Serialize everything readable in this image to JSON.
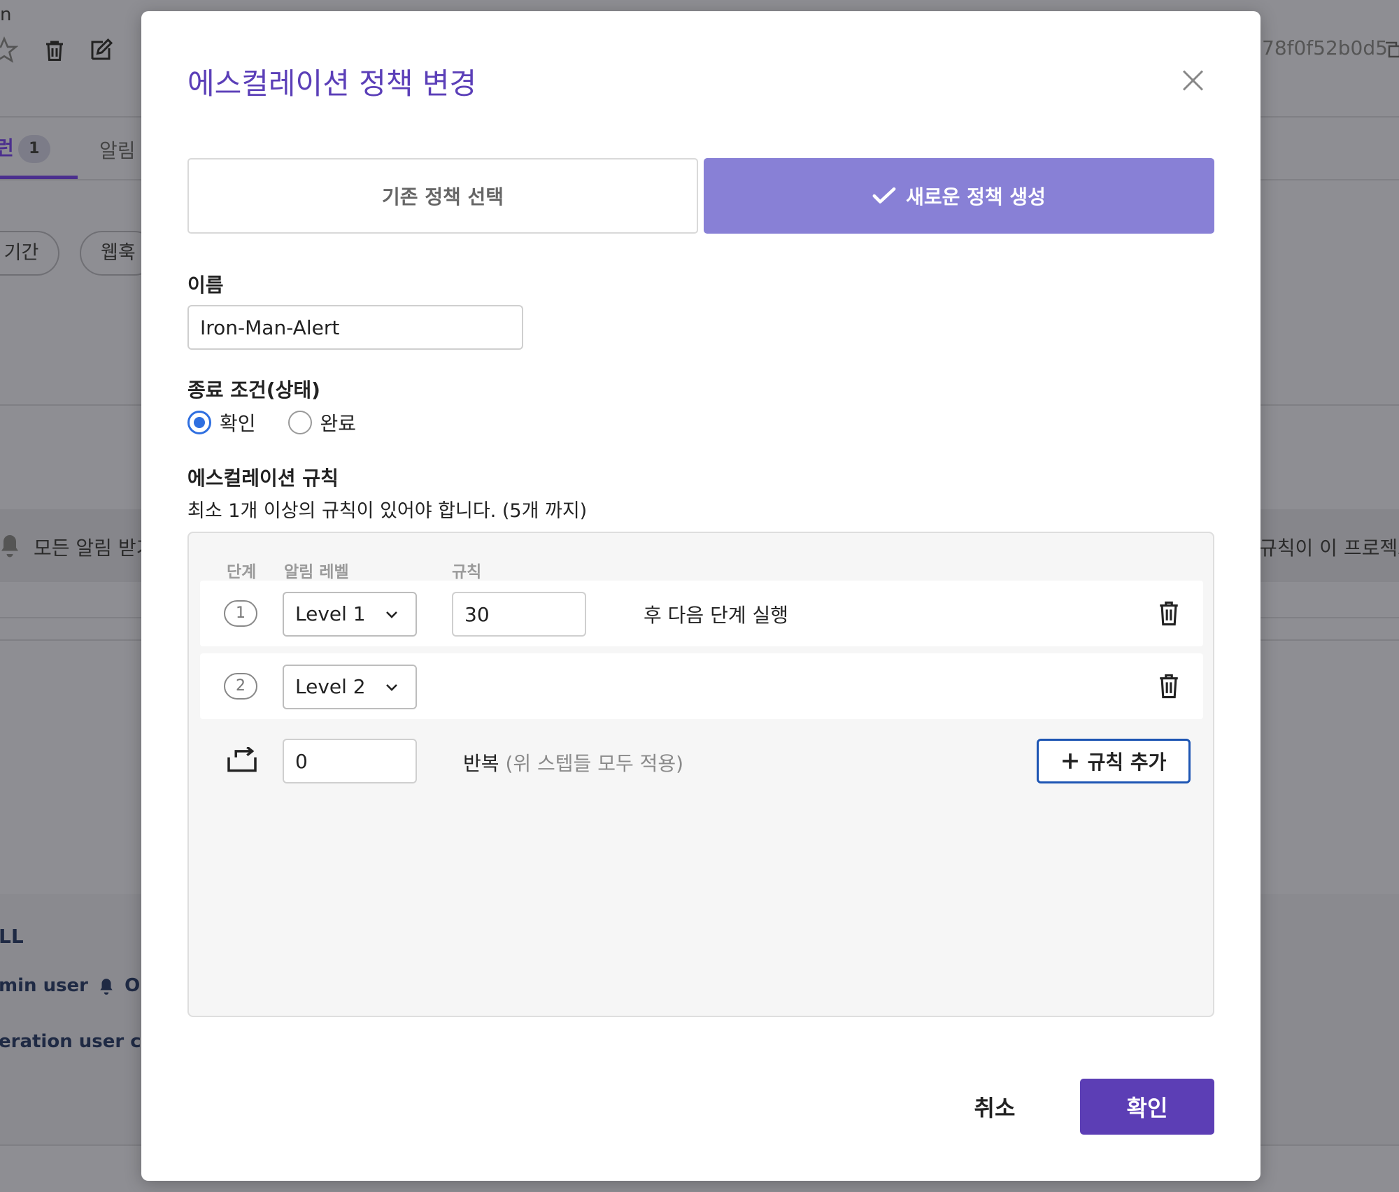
{
  "background": {
    "corner_text": "n",
    "tabs": [
      {
        "label": "런",
        "badge": "1"
      },
      {
        "label": "알림"
      }
    ],
    "filter_pills": [
      "| 기간",
      "웹훅"
    ],
    "hash_text": "78f0f52b0d5",
    "notify_text": "모든 알림 받기",
    "right_rule_text": "규칙이 이 프로젝트",
    "section_title": "LL",
    "user_line_1": {
      "prefix": "min user",
      "status": "ON"
    },
    "user_line_2": "eration user char"
  },
  "modal": {
    "title": "에스컬레이션 정책 변경",
    "segments": {
      "existing": "기존 정책 선택",
      "new": "새로운 정책 생성",
      "active": "new"
    },
    "name": {
      "label": "이름",
      "value": "Iron-Man-Alert"
    },
    "end_condition": {
      "label": "종료 조건(상태)",
      "options": [
        "확인",
        "완료"
      ],
      "selected": "확인"
    },
    "rules": {
      "label": "에스컬레이션 규칙",
      "description": "최소 1개 이상의 규칙이 있어야 합니다. (5개 까지)",
      "columns": [
        "단계",
        "알림 레벨",
        "규칙"
      ],
      "rows": [
        {
          "step": "1",
          "level": "Level 1",
          "minutes": "30",
          "after_text": "후 다음 단계 실행"
        },
        {
          "step": "2",
          "level": "Level 2"
        }
      ],
      "repeat": {
        "value": "0",
        "label": "반복",
        "note": "(위 스텝들 모두 적용)"
      },
      "add_button": "규칙 추가"
    },
    "buttons": {
      "cancel": "취소",
      "confirm": "확인"
    }
  },
  "colors": {
    "title": "#5b3fb8",
    "segment_active": "#8880d6",
    "confirm": "#5c3eb5",
    "radio": "#2f6fe0",
    "add_border": "#1d55b3"
  }
}
